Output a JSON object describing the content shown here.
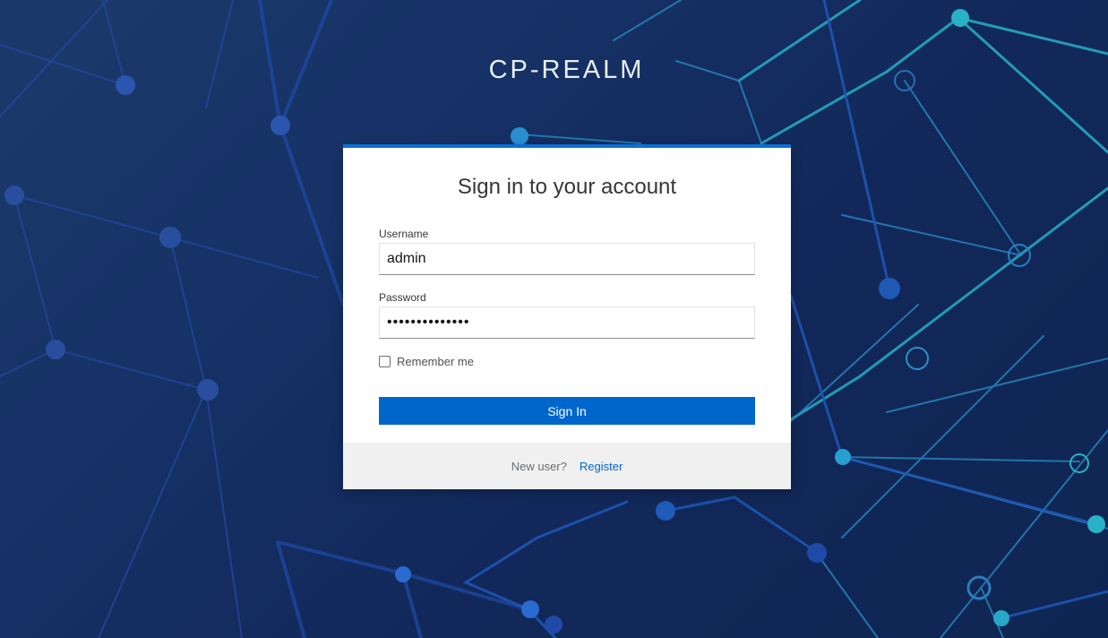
{
  "realm": {
    "title": "CP-REALM"
  },
  "login": {
    "heading": "Sign in to your account",
    "username_label": "Username",
    "username_value": "admin",
    "password_label": "Password",
    "password_value": "••••••••••••••",
    "remember_label": "Remember me",
    "remember_checked": false,
    "signin_label": "Sign In"
  },
  "footer": {
    "new_user_text": "New user?",
    "register_label": "Register"
  },
  "colors": {
    "accent": "#0066cc",
    "background": "#163266",
    "circuit": "#2a9fc4"
  }
}
